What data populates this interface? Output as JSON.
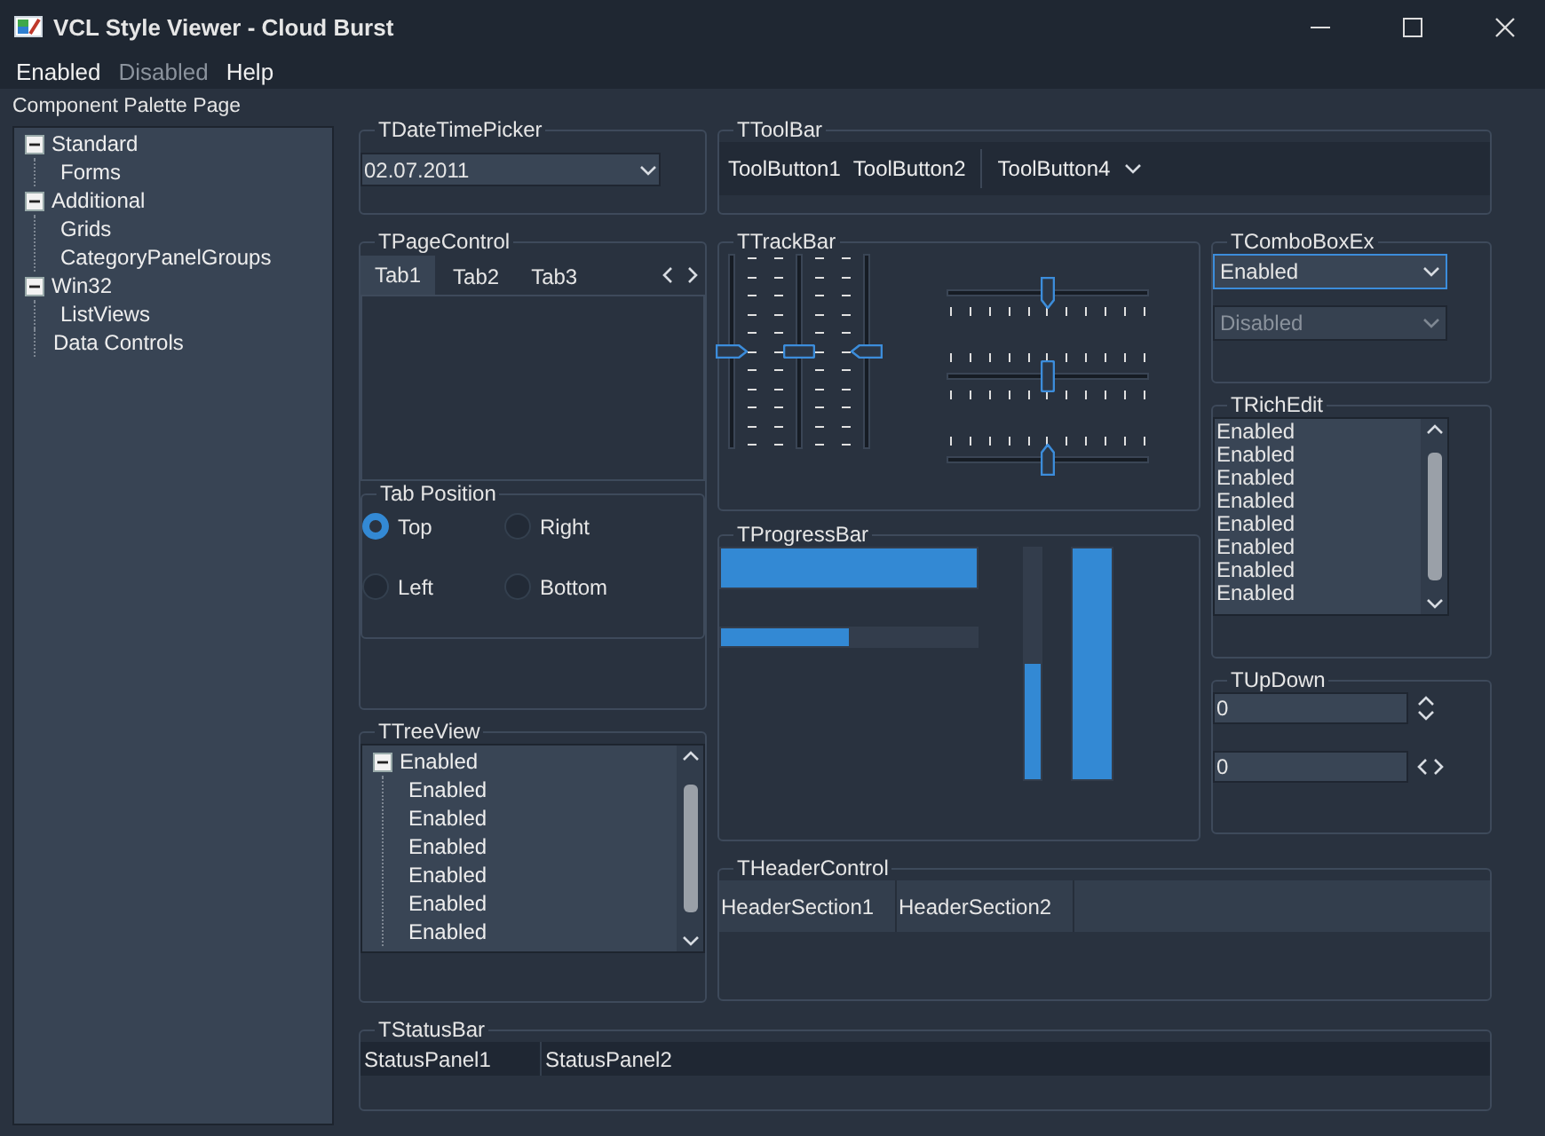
{
  "window": {
    "title": "VCL Style Viewer - Cloud Burst"
  },
  "menu": [
    {
      "label": "Enabled",
      "disabled": false
    },
    {
      "label": "Disabled",
      "disabled": true
    },
    {
      "label": "Help",
      "disabled": false
    }
  ],
  "sidebar": {
    "title": "Component Palette Page",
    "tree": [
      {
        "label": "Standard",
        "expanded": true,
        "children": [
          {
            "label": "Forms"
          }
        ]
      },
      {
        "label": "Additional",
        "expanded": true,
        "children": [
          {
            "label": "Grids"
          },
          {
            "label": "CategoryPanelGroups"
          }
        ]
      },
      {
        "label": "Win32",
        "expanded": true,
        "children": [
          {
            "label": "ListViews"
          }
        ]
      },
      {
        "label": "Data Controls"
      }
    ]
  },
  "date_time_picker": {
    "title": "TDateTimePicker",
    "value": "02.07.2011"
  },
  "toolbar": {
    "title": "TToolBar",
    "buttons": [
      {
        "label": "ToolButton1",
        "kind": "button"
      },
      {
        "label": "ToolButton2",
        "kind": "button"
      },
      {
        "label": "ToolButton4",
        "kind": "dropdown"
      }
    ]
  },
  "page_control": {
    "title": "TPageControl",
    "tabs": [
      {
        "label": "Tab1",
        "selected": true
      },
      {
        "label": "Tab2",
        "selected": false
      },
      {
        "label": "Tab3",
        "selected": false
      }
    ],
    "tab_position": {
      "title": "Tab Position",
      "options": [
        {
          "label": "Top",
          "selected": true
        },
        {
          "label": "Right",
          "selected": false
        },
        {
          "label": "Left",
          "selected": false
        },
        {
          "label": "Bottom",
          "selected": false
        }
      ]
    }
  },
  "tree_view": {
    "title": "TTreeView",
    "items": [
      {
        "label": "Enabled",
        "expanded": true,
        "children": [
          {
            "label": "Enabled"
          },
          {
            "label": "Enabled"
          },
          {
            "label": "Enabled"
          },
          {
            "label": "Enabled"
          },
          {
            "label": "Enabled"
          },
          {
            "label": "Enabled"
          }
        ]
      }
    ]
  },
  "track_bar": {
    "title": "TTrackBar",
    "vertical": [
      {
        "kind": "point-right",
        "level": 0.5
      },
      {
        "kind": "both",
        "level": 0.5
      },
      {
        "kind": "point-left",
        "level": 0.5
      }
    ],
    "horizontal": [
      {
        "kind": "point-down",
        "level": 0.5
      },
      {
        "kind": "both",
        "level": 0.5
      },
      {
        "kind": "point-up",
        "level": 0.5
      }
    ]
  },
  "progress_bar": {
    "title": "TProgressBar",
    "bars": [
      {
        "kind": "wide-row",
        "level": 1
      },
      {
        "kind": "thin-row",
        "level": 0.5
      },
      {
        "kind": "thin-column",
        "level": 0.5
      },
      {
        "kind": "wide-column",
        "level": 1
      }
    ]
  },
  "combo_box_ex": {
    "title": "TComboBoxEx",
    "boxes": [
      {
        "value": "Enabled",
        "disabled": false,
        "focused": true
      },
      {
        "value": "Disabled",
        "disabled": true,
        "focused": false
      }
    ]
  },
  "rich_edit": {
    "title": "TRichEdit",
    "lines": [
      "Enabled",
      "Enabled",
      "Enabled",
      "Enabled",
      "Enabled",
      "Enabled",
      "Enabled",
      "Enabled"
    ]
  },
  "up_down": {
    "title": "TUpDown",
    "fields": [
      {
        "value": "0",
        "kind": "updown"
      },
      {
        "value": "0",
        "kind": "leftright"
      }
    ]
  },
  "header_control": {
    "title": "THeaderControl",
    "sections": [
      "HeaderSection1",
      "HeaderSection2"
    ]
  },
  "status_bar": {
    "title": "TStatusBar",
    "panels": [
      "StatusPanel1",
      "StatusPanel2"
    ]
  }
}
